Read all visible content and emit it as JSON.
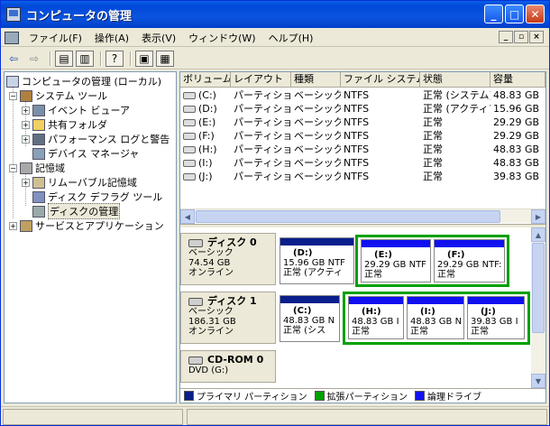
{
  "window": {
    "title": "コンピュータの管理"
  },
  "menu": [
    "ファイル(F)",
    "操作(A)",
    "表示(V)",
    "ウィンドウ(W)",
    "ヘルプ(H)"
  ],
  "mdi": {
    "minimize": "_",
    "restore": "▫",
    "close": "×"
  },
  "tree": {
    "root": "コンピュータの管理 (ローカル)",
    "system_tools": "システム ツール",
    "event_viewer": "イベント ビューア",
    "shared_folders": "共有フォルダ",
    "perf_logs": "パフォーマンス ログと警告",
    "device_manager": "デバイス マネージャ",
    "storage": "記憶域",
    "removable": "リムーバブル記憶域",
    "defrag": "ディスク デフラグ ツール",
    "disk_mgmt": "ディスクの管理",
    "services": "サービスとアプリケーション"
  },
  "columns": [
    "ボリューム",
    "レイアウト",
    "種類",
    "ファイル システム",
    "状態",
    "容量"
  ],
  "volumes": [
    [
      "(C:)",
      "パーティション",
      "ベーシック",
      "NTFS",
      "正常 (システム)",
      "48.83 GB"
    ],
    [
      "(D:)",
      "パーティション",
      "ベーシック",
      "NTFS",
      "正常 (アクティブ)",
      "15.96 GB"
    ],
    [
      "(E:)",
      "パーティション",
      "ベーシック",
      "NTFS",
      "正常",
      "29.29 GB"
    ],
    [
      "(F:)",
      "パーティション",
      "ベーシック",
      "NTFS",
      "正常",
      "29.29 GB"
    ],
    [
      "(H:)",
      "パーティション",
      "ベーシック",
      "NTFS",
      "正常",
      "48.83 GB"
    ],
    [
      "(I:)",
      "パーティション",
      "ベーシック",
      "NTFS",
      "正常",
      "48.83 GB"
    ],
    [
      "(J:)",
      "パーティション",
      "ベーシック",
      "NTFS",
      "正常",
      "39.83 GB"
    ]
  ],
  "disks": [
    {
      "name": "ディスク 0",
      "type": "ベーシック",
      "size": "74.54 GB",
      "status": "オンライン"
    },
    {
      "name": "ディスク 1",
      "type": "ベーシック",
      "size": "186.31 GB",
      "status": "オンライン"
    },
    {
      "name": "CD-ROM 0",
      "type": "DVD (G:)"
    }
  ],
  "parts": {
    "d": {
      "name": "(D:)",
      "info": "15.96 GB NTF",
      "status": "正常 (アクティ"
    },
    "e": {
      "name": "(E:)",
      "info": "29.29 GB NTF",
      "status": "正常"
    },
    "f": {
      "name": "(F:)",
      "info": "29.29 GB NTF:",
      "status": "正常"
    },
    "c": {
      "name": "(C:)",
      "info": "48.83 GB N",
      "status": "正常 (シス"
    },
    "h": {
      "name": "(H:)",
      "info": "48.83 GB I",
      "status": "正常"
    },
    "i": {
      "name": "(I:)",
      "info": "48.83 GB N",
      "status": "正常"
    },
    "j": {
      "name": "(J:)",
      "info": "39.83 GB I",
      "status": "正常"
    }
  },
  "legend": {
    "primary": "プライマリ パーティション",
    "extended": "拡張パーティション",
    "logical": "論理ドライブ"
  },
  "colors": {
    "primary": "#0a1e8c",
    "extended": "#00a000",
    "logical": "#1010f0",
    "titlebar": "#0a54e0"
  }
}
